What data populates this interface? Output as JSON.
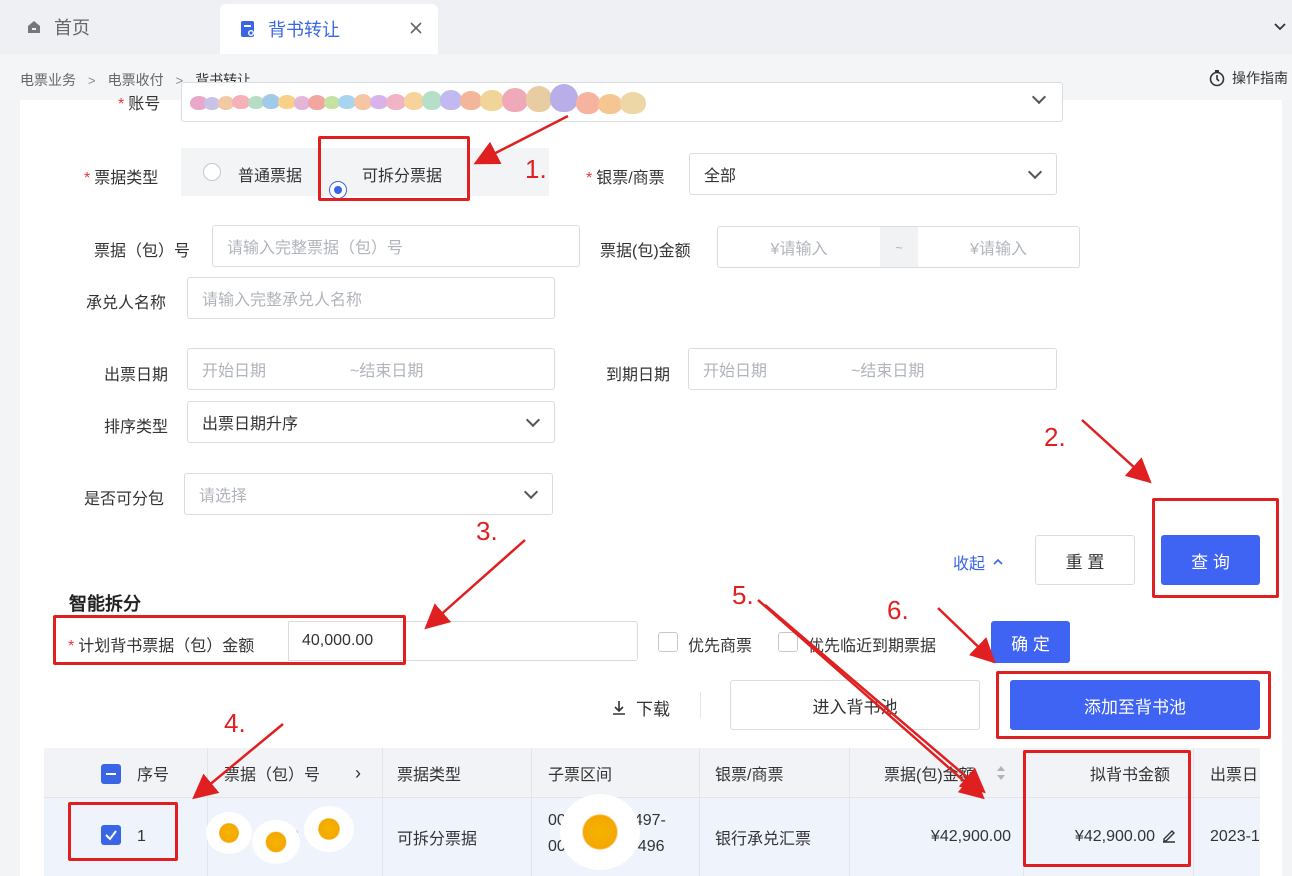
{
  "tabs": {
    "home": "首页",
    "active": "背书转让"
  },
  "breadcrumb": [
    "电票业务",
    "电票收付",
    "背书转让"
  ],
  "guide_label": "操作指南",
  "form": {
    "account_label": "账号",
    "bill_type_label": "票据类型",
    "bill_type_options": [
      "普通票据",
      "可拆分票据"
    ],
    "bill_type_selected": "可拆分票据",
    "bank_commercial_label": "银票/商票",
    "bank_commercial_value": "全部",
    "bill_no_label": "票据（包）号",
    "bill_no_placeholder": "请输入完整票据（包）号",
    "bill_amount_label": "票据(包)金额",
    "amount_min_placeholder": "¥请输入",
    "amount_sep": "~",
    "amount_max_placeholder": "¥请输入",
    "acceptor_label": "承兑人名称",
    "acceptor_placeholder": "请输入完整承兑人名称",
    "issue_date_label": "出票日期",
    "issue_start_placeholder": "开始日期",
    "issue_end_placeholder": "~结束日期",
    "due_date_label": "到期日期",
    "due_start_placeholder": "开始日期",
    "due_end_placeholder": "~结束日期",
    "sort_label": "排序类型",
    "sort_value": "出票日期升序",
    "split_label": "是否可分包",
    "split_placeholder": "请选择",
    "collapse_label": "收起",
    "reset_label": "重 置",
    "query_label": "查 询"
  },
  "smart_split": {
    "title": "智能拆分",
    "plan_label": "计划背书票据（包）金额",
    "plan_value": "40,000.00",
    "prefer_commercial": "优先商票",
    "prefer_near_due": "优先临近到期票据",
    "confirm_label": "确 定"
  },
  "actions": {
    "download_label": "下载",
    "enter_pool_label": "进入背书池",
    "add_pool_label": "添加至背书池"
  },
  "table": {
    "headers": [
      "序号",
      "票据（包）号",
      "票据类型",
      "子票区间",
      "银票/商票",
      "票据(包)金额",
      "拟背书金额",
      "出票日"
    ],
    "rows": [
      {
        "index": "1",
        "bill_no": "0",
        "bill_type": "可拆分票据",
        "range_1": "00",
        "range_1_tail": "497-",
        "range_2": "00",
        "range_2_tail": "496",
        "bank_type": "银行承兑汇票",
        "amount": "¥42,900.00",
        "endorse_amount": "¥42,900.00",
        "issue_date": "2023-1"
      }
    ]
  },
  "annotations": [
    "1.",
    "2.",
    "3.",
    "4.",
    "5.",
    "6."
  ],
  "colors": {
    "primary": "#3f63f3",
    "annotation_red": "#e02020",
    "required": "#e53935"
  }
}
